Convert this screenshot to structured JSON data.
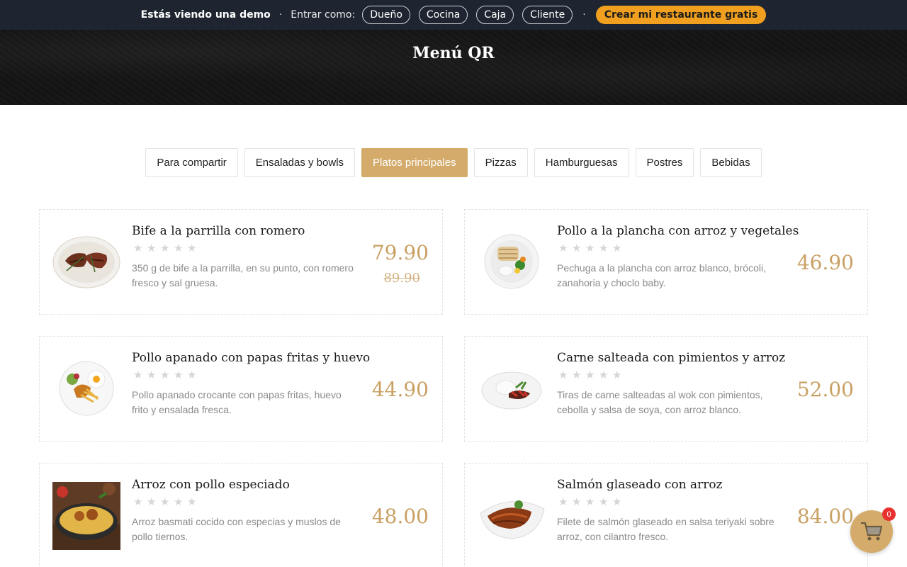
{
  "demo_bar": {
    "demo_text": "Estás viendo una demo",
    "separator": "·",
    "enter_as": "Entrar como:",
    "roles": [
      "Dueño",
      "Cocina",
      "Caja",
      "Cliente"
    ],
    "cta": "Crear mi restaurante gratis"
  },
  "hero": {
    "title": "Menú QR"
  },
  "tabs": [
    {
      "label": "Para compartir"
    },
    {
      "label": "Ensaladas y bowls"
    },
    {
      "label": "Platos principales"
    },
    {
      "label": "Pizzas"
    },
    {
      "label": "Hamburguesas"
    },
    {
      "label": "Postres"
    },
    {
      "label": "Bebidas"
    }
  ],
  "active_tab": "Platos principales",
  "dishes": [
    {
      "name": "Bife a la parrilla con romero",
      "desc": "350 g de bife a la parrilla, en su punto, con romero fresco y sal gruesa.",
      "price": "79.90",
      "old_price": "89.90",
      "rating": 0
    },
    {
      "name": "Pollo a la plancha con arroz y vegetales",
      "desc": "Pechuga a la plancha con arroz blanco, brócoli, zanahoria y choclo baby.",
      "price": "46.90",
      "rating": 0
    },
    {
      "name": "Pollo apanado con papas fritas y huevo",
      "desc": "Pollo apanado crocante con papas fritas, huevo frito y ensalada fresca.",
      "price": "44.90",
      "rating": 0
    },
    {
      "name": "Carne salteada con pimientos y arroz",
      "desc": "Tiras de carne salteadas al wok con pimientos, cebolla y salsa de soya, con arroz blanco.",
      "price": "52.00",
      "rating": 0
    },
    {
      "name": "Arroz con pollo especiado",
      "desc": "Arroz basmati cocido con especias y muslos de pollo tiernos.",
      "price": "48.00",
      "rating": 0
    },
    {
      "name": "Salmón glaseado con arroz",
      "desc": "Filete de salmón glaseado en salsa teriyaki sobre arroz, con cilantro fresco.",
      "price": "84.00",
      "rating": 0
    }
  ],
  "cart": {
    "count": "0",
    "icon": "shopping-cart-icon"
  },
  "colors": {
    "accent": "#d4ab6a",
    "cta": "#f0a01e",
    "topbar": "#1e2530",
    "badge": "#e8322f"
  }
}
